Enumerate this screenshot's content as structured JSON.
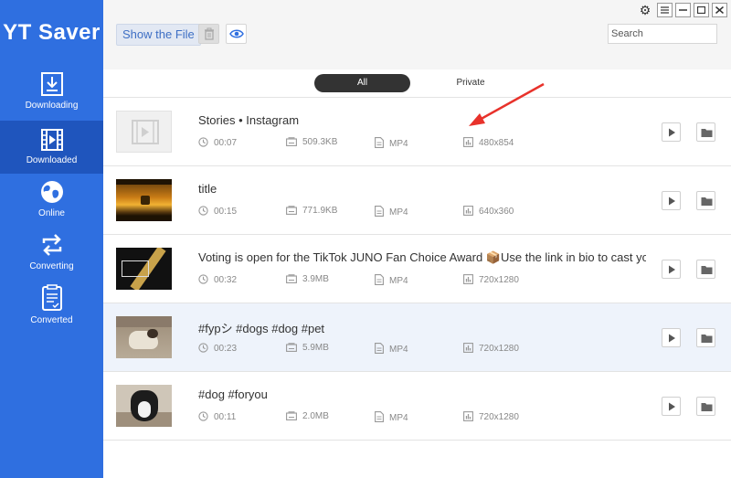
{
  "app": {
    "title": "YT Saver"
  },
  "sidebar": {
    "items": [
      {
        "label": "Downloading",
        "icon": "download-icon",
        "active": false
      },
      {
        "label": "Downloaded",
        "icon": "film-icon",
        "active": true
      },
      {
        "label": "Online",
        "icon": "globe-icon",
        "active": false
      },
      {
        "label": "Converting",
        "icon": "convert-icon",
        "active": false
      },
      {
        "label": "Converted",
        "icon": "document-icon",
        "active": false
      }
    ]
  },
  "toolbar": {
    "show_file_label": "Show the File",
    "search_placeholder": "Search",
    "search_value": ""
  },
  "tabs": {
    "all_label": "All",
    "private_label": "Private",
    "selected": "All"
  },
  "colors": {
    "sidebar": "#2f6fe0",
    "sidebar_active": "#1f55bd",
    "accent": "#3e6fc4",
    "arrow": "#e8322b"
  },
  "items": [
    {
      "title": "Stories • Instagram",
      "duration": "00:07",
      "size": "509.3KB",
      "format": "MP4",
      "resolution": "480x854",
      "thumb": "placeholder"
    },
    {
      "title": "title",
      "duration": "00:15",
      "size": "771.9KB",
      "format": "MP4",
      "resolution": "640x360",
      "thumb": "sunset-mtv"
    },
    {
      "title": "Voting is open for the TikTok JUNO Fan Choice Award 📦Use the link in bio to cast your v",
      "duration": "00:32",
      "size": "3.9MB",
      "format": "MP4",
      "resolution": "720x1280",
      "thumb": "fan-choice"
    },
    {
      "title": "#fypシ #dogs #dog #pet",
      "duration": "00:23",
      "size": "5.9MB",
      "format": "MP4",
      "resolution": "720x1280",
      "thumb": "dog-floor"
    },
    {
      "title": "#dog #foryou",
      "duration": "00:11",
      "size": "2.0MB",
      "format": "MP4",
      "resolution": "720x1280",
      "thumb": "dog-face"
    }
  ]
}
